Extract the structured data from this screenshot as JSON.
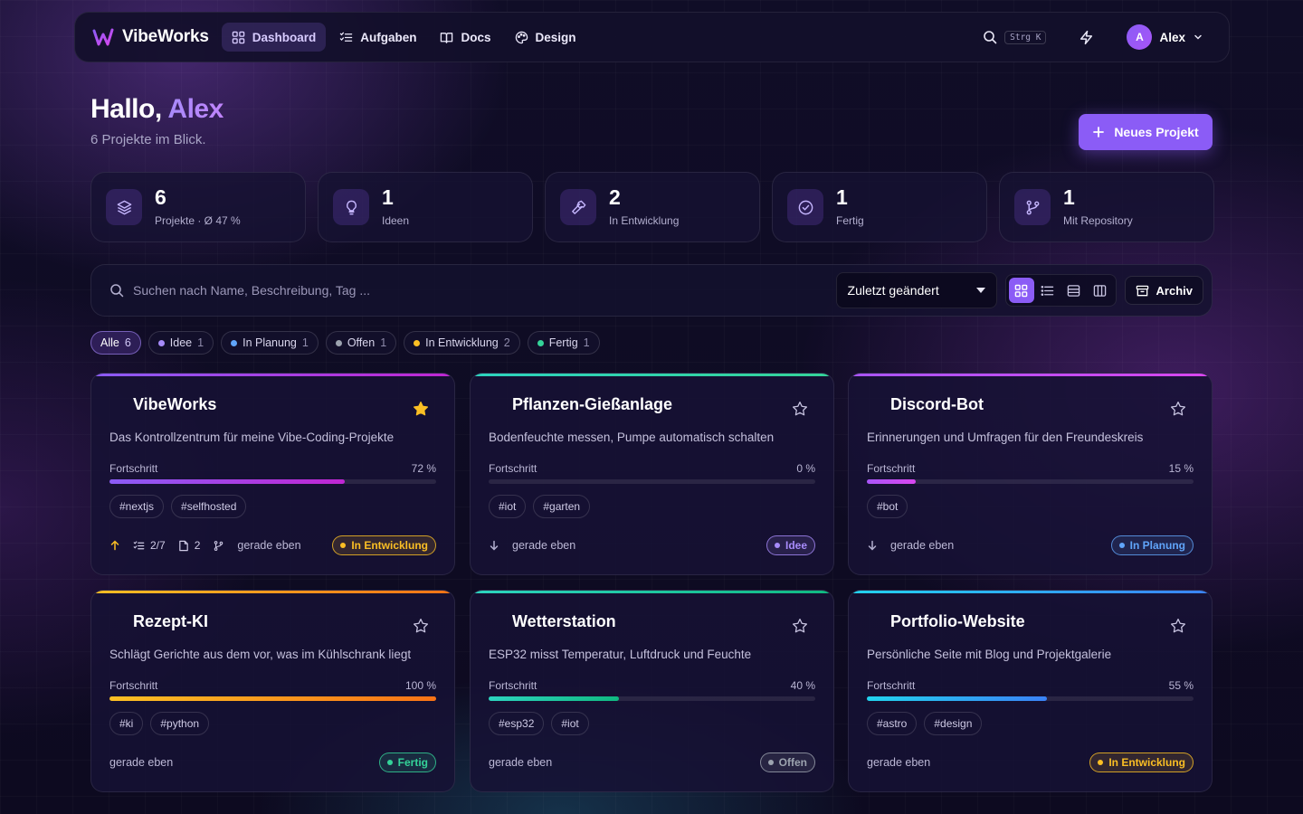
{
  "nav": {
    "brand": "VibeWorks",
    "links": [
      {
        "label": "Dashboard",
        "icon": "dashboard-icon",
        "active": true
      },
      {
        "label": "Aufgaben",
        "icon": "checklist-icon",
        "active": false
      },
      {
        "label": "Docs",
        "icon": "book-icon",
        "active": false
      },
      {
        "label": "Design",
        "icon": "palette-icon",
        "active": false
      }
    ],
    "search_shortcut": "Strg K",
    "user": {
      "initial": "A",
      "name": "Alex"
    }
  },
  "header": {
    "greeting_prefix": "Hallo,",
    "greeting_name": "Alex",
    "subline": "6 Projekte im Blick.",
    "new_project_label": "Neues Projekt"
  },
  "stats": [
    {
      "value": "6",
      "label": "Projekte · Ø 47 %",
      "icon": "layers-icon"
    },
    {
      "value": "1",
      "label": "Ideen",
      "icon": "lightbulb-icon"
    },
    {
      "value": "2",
      "label": "In Entwicklung",
      "icon": "hammer-icon"
    },
    {
      "value": "1",
      "label": "Fertig",
      "icon": "check-circle-icon"
    },
    {
      "value": "1",
      "label": "Mit Repository",
      "icon": "git-branch-icon"
    }
  ],
  "toolbar": {
    "search_placeholder": "Suchen nach Name, Beschreibung, Tag ...",
    "sort_value": "Zuletzt geändert",
    "view_modes": [
      "grid",
      "list",
      "rows",
      "columns"
    ],
    "active_view": "grid",
    "archive_label": "Archiv"
  },
  "filters": [
    {
      "label": "Alle",
      "count": "6",
      "active": true,
      "color": null
    },
    {
      "label": "Idee",
      "count": "1",
      "active": false,
      "color": "#a78bfa"
    },
    {
      "label": "In Planung",
      "count": "1",
      "active": false,
      "color": "#60a5fa"
    },
    {
      "label": "Offen",
      "count": "1",
      "active": false,
      "color": "#9ca3af"
    },
    {
      "label": "In Entwicklung",
      "count": "2",
      "active": false,
      "color": "#fbbf24"
    },
    {
      "label": "Fertig",
      "count": "1",
      "active": false,
      "color": "#34d399"
    }
  ],
  "progress_label": "Fortschritt",
  "projects": [
    {
      "title": "VibeWorks",
      "description": "Das Kontrollzentrum für meine Vibe-Coding-Projekte",
      "progress": 72,
      "progress_text": "72 %",
      "tags": [
        "#nextjs",
        "#selfhosted"
      ],
      "starred": true,
      "bar_colors": [
        "#8b5cf6",
        "#c026d3"
      ],
      "trend": "up",
      "meta": {
        "tasks": "2/7",
        "docs": "2",
        "repo": true
      },
      "time": "gerade eben",
      "status": "In Entwicklung",
      "status_color": "#fbbf24"
    },
    {
      "title": "Pflanzen-Gießanlage",
      "description": "Bodenfeuchte messen, Pumpe automatisch schalten",
      "progress": 0,
      "progress_text": "0 %",
      "tags": [
        "#iot",
        "#garten"
      ],
      "starred": false,
      "bar_colors": [
        "#2dd4bf",
        "#34d399"
      ],
      "trend": "down",
      "meta": null,
      "time": "gerade eben",
      "status": "Idee",
      "status_color": "#a78bfa"
    },
    {
      "title": "Discord-Bot",
      "description": "Erinnerungen und Umfragen für den Freundeskreis",
      "progress": 15,
      "progress_text": "15 %",
      "tags": [
        "#bot"
      ],
      "starred": false,
      "bar_colors": [
        "#a855f7",
        "#d946ef"
      ],
      "trend": "down",
      "meta": null,
      "time": "gerade eben",
      "status": "In Planung",
      "status_color": "#60a5fa"
    },
    {
      "title": "Rezept-KI",
      "description": "Schlägt Gerichte aus dem vor, was im Kühlschrank liegt",
      "progress": 100,
      "progress_text": "100 %",
      "tags": [
        "#ki",
        "#python"
      ],
      "starred": false,
      "bar_colors": [
        "#fbbf24",
        "#f97316"
      ],
      "trend": null,
      "meta": null,
      "time": "gerade eben",
      "status": "Fertig",
      "status_color": "#34d399"
    },
    {
      "title": "Wetterstation",
      "description": "ESP32 misst Temperatur, Luftdruck und Feuchte",
      "progress": 40,
      "progress_text": "40 %",
      "tags": [
        "#esp32",
        "#iot"
      ],
      "starred": false,
      "bar_colors": [
        "#2dd4bf",
        "#10b981"
      ],
      "trend": null,
      "meta": null,
      "time": "gerade eben",
      "status": "Offen",
      "status_color": "#9ca3af"
    },
    {
      "title": "Portfolio-Website",
      "description": "Persönliche Seite mit Blog und Projektgalerie",
      "progress": 55,
      "progress_text": "55 %",
      "tags": [
        "#astro",
        "#design"
      ],
      "starred": false,
      "bar_colors": [
        "#22d3ee",
        "#3b82f6"
      ],
      "trend": null,
      "meta": null,
      "time": "gerade eben",
      "status": "In Entwicklung",
      "status_color": "#fbbf24"
    }
  ]
}
